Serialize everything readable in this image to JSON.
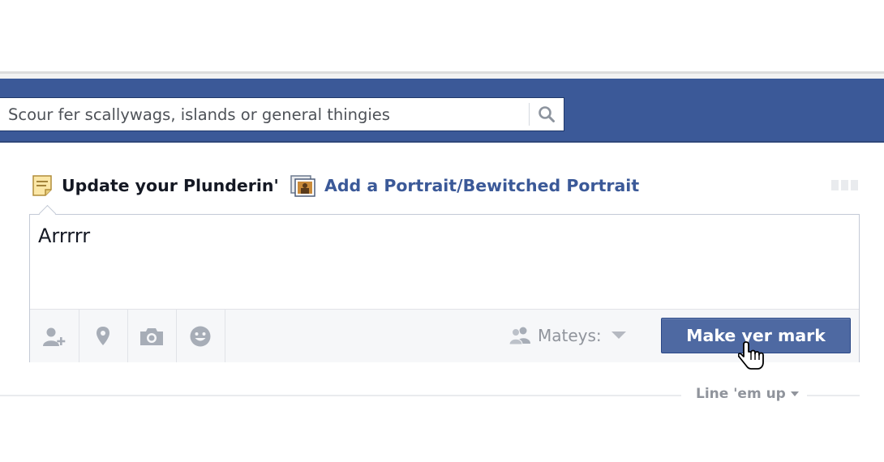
{
  "search": {
    "placeholder": "Scour fer scallywags, islands or general thingies",
    "icon": "search-icon"
  },
  "composer": {
    "tabs": [
      {
        "label": "Update your Plunderin'",
        "icon": "note-icon",
        "active": true
      },
      {
        "label": "Add a Portrait/Bewitched Portrait",
        "icon": "photo-album-icon",
        "active": false
      }
    ],
    "text": "Arrrrr",
    "tools": [
      {
        "icon": "tag-friends-icon"
      },
      {
        "icon": "location-pin-icon"
      },
      {
        "icon": "camera-icon"
      },
      {
        "icon": "smiley-icon"
      }
    ],
    "audience": {
      "label": "Mateys:",
      "icon": "friends-icon"
    },
    "post_button": "Make yer mark"
  },
  "feed": {
    "sort_label": "Line 'em up"
  },
  "colors": {
    "brand_blue": "#3b5998",
    "button_blue": "#4e69a2",
    "muted_text": "#90949c"
  }
}
